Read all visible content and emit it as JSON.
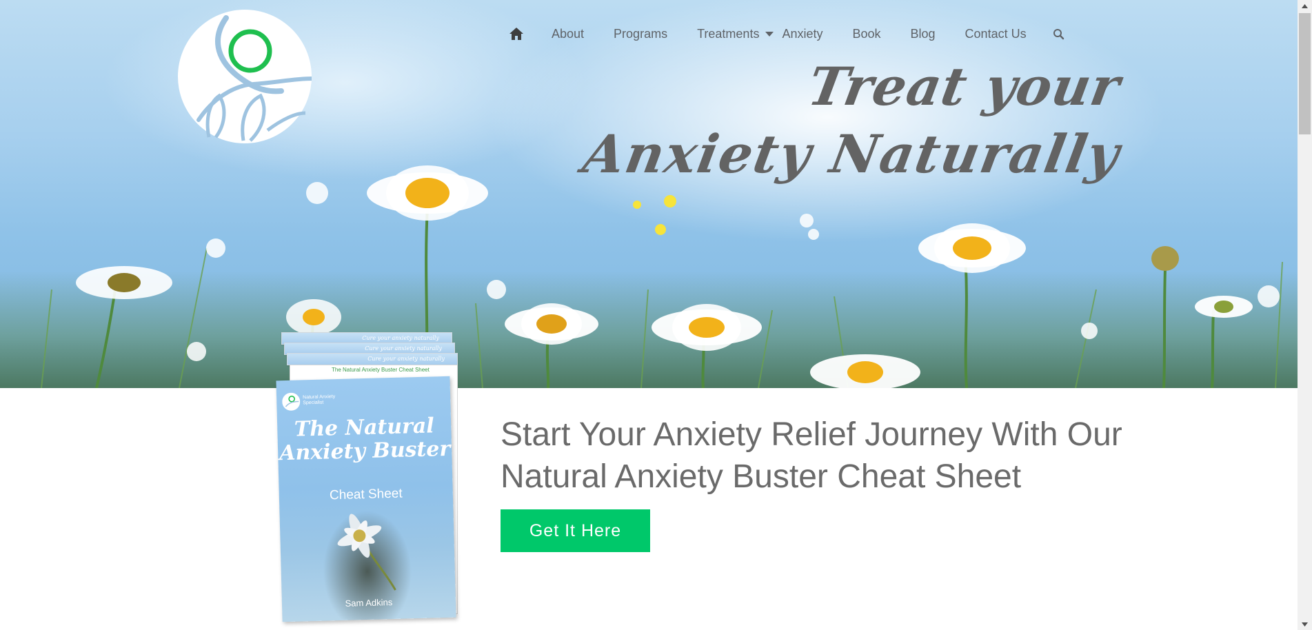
{
  "colors": {
    "nav_text": "#5f6368",
    "heading_text": "#6a6a6a",
    "cta_bg": "#00c86a",
    "cta_text": "#ffffff",
    "logo_ring": "#1fbf4f",
    "logo_stroke": "#9ec3e0"
  },
  "logo": {
    "icon": "natural-anxiety-logo-icon"
  },
  "nav": {
    "home_icon": "home-icon",
    "items": [
      "About",
      "Programs",
      "Treatments",
      "Anxiety",
      "Book",
      "Blog",
      "Contact Us"
    ],
    "treatments_dropdown_icon": "caret-down-icon",
    "search_icon": "search-icon"
  },
  "hero": {
    "title_line1": "Treat your",
    "title_line2": "Anxiety Naturally"
  },
  "promo": {
    "heading": "Start Your Anxiety Relief Journey With Our Natural Anxiety Buster Cheat Sheet",
    "cta_label": "Get It Here"
  },
  "book": {
    "sheet_tagline": "Cure your anxiety naturally",
    "sheet_title": "The Natural Anxiety Buster Cheat Sheet",
    "cover_brand": "Natural Anxiety Specialist",
    "cover_title": "The Natural Anxiety Buster",
    "cover_subtitle": "Cheat Sheet",
    "cover_author": "Sam Adkins"
  }
}
